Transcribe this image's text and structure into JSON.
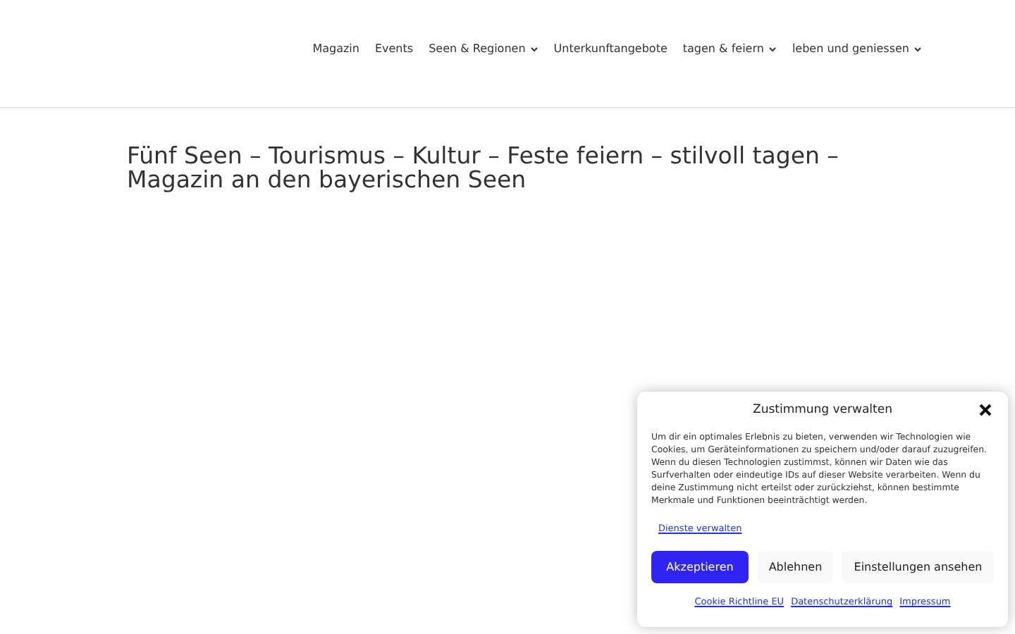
{
  "nav": {
    "items": [
      {
        "label": "Magazin",
        "has_submenu": false
      },
      {
        "label": "Events",
        "has_submenu": false
      },
      {
        "label": "Seen & Regionen",
        "has_submenu": true
      },
      {
        "label": "Unterkunftangebote",
        "has_submenu": false
      },
      {
        "label": "tagen & feiern",
        "has_submenu": true
      },
      {
        "label": "leben und geniessen",
        "has_submenu": true
      }
    ]
  },
  "page_title": "Fünf Seen – Tourismus – Kultur – Feste feiern – stilvoll tagen – Magazin an den bayerischen Seen",
  "consent": {
    "title": "Zustimmung verwalten",
    "text": "Um dir ein optimales Erlebnis zu bieten, verwenden wir Technologien wie Cookies, um Geräteinformationen zu speichern und/oder darauf zuzugreifen. Wenn du diesen Technologien zustimmst, können wir Daten wie das Surfverhalten oder eindeutige IDs auf dieser Website verarbeiten. Wenn du deine Zustimmung nicht erteilst oder zurückziehst, können bestimmte Merkmale und Funktionen beeinträchtigt werden.",
    "manage_link": "Dienste verwalten",
    "buttons": [
      {
        "label": "Akzeptieren",
        "kind": "primary"
      },
      {
        "label": "Ablehnen",
        "kind": "secondary"
      },
      {
        "label": "Einstellungen ansehen",
        "kind": "secondary"
      }
    ],
    "footer_links": [
      "Cookie Richtline EU",
      "Datenschutzerklärung",
      "Impressum"
    ]
  }
}
